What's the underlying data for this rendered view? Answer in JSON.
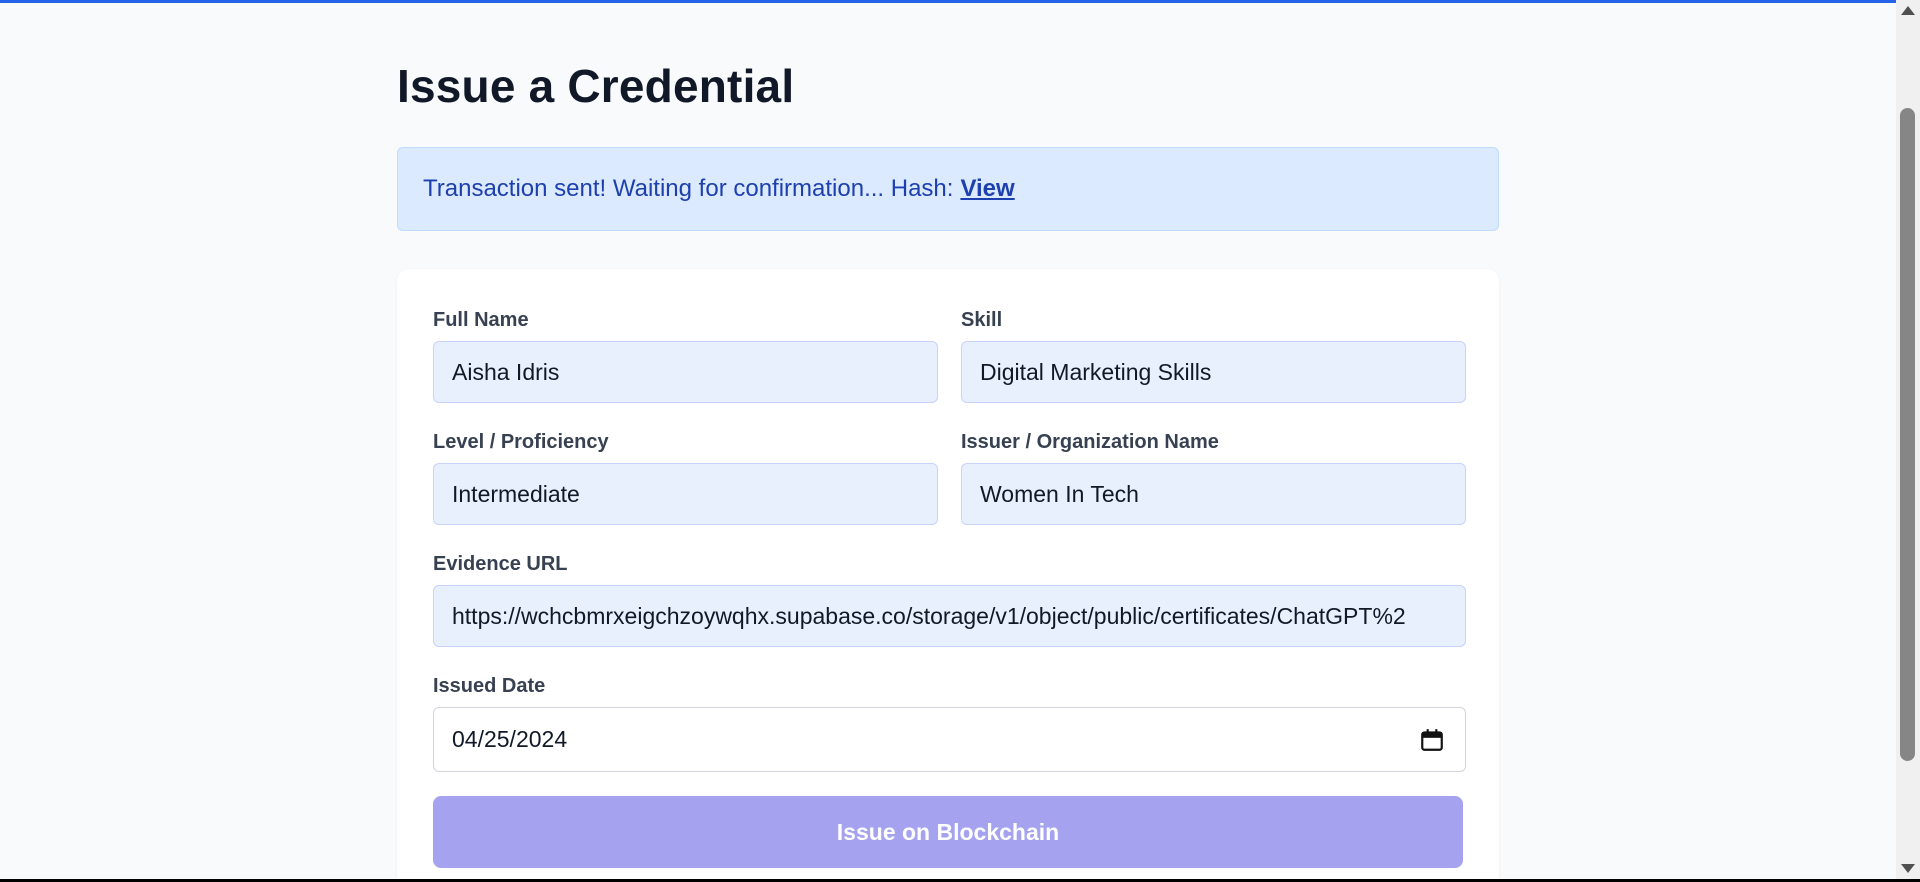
{
  "page": {
    "title": "Issue a Credential"
  },
  "alert": {
    "message": "Transaction sent! Waiting for confirmation... Hash:",
    "link_label": "View"
  },
  "form": {
    "full_name": {
      "label": "Full Name",
      "value": "Aisha Idris"
    },
    "skill": {
      "label": "Skill",
      "value": "Digital Marketing Skills"
    },
    "level": {
      "label": "Level / Proficiency",
      "value": "Intermediate"
    },
    "issuer": {
      "label": "Issuer / Organization Name",
      "value": "Women In Tech"
    },
    "evidence_url": {
      "label": "Evidence URL",
      "value": "https://wchcbmrxeigchzoywqhx.supabase.co/storage/v1/object/public/certificates/ChatGPT%2"
    },
    "issued_date": {
      "label": "Issued Date",
      "value": "04/25/2024",
      "icon": "calendar-icon"
    },
    "submit_label": "Issue on Blockchain"
  },
  "colors": {
    "accent_top_border": "#2563eb",
    "alert_bg": "#dbeafe",
    "alert_text": "#1e40af",
    "button_bg": "#a5a3f0",
    "input_bg": "#e8f0fe"
  }
}
